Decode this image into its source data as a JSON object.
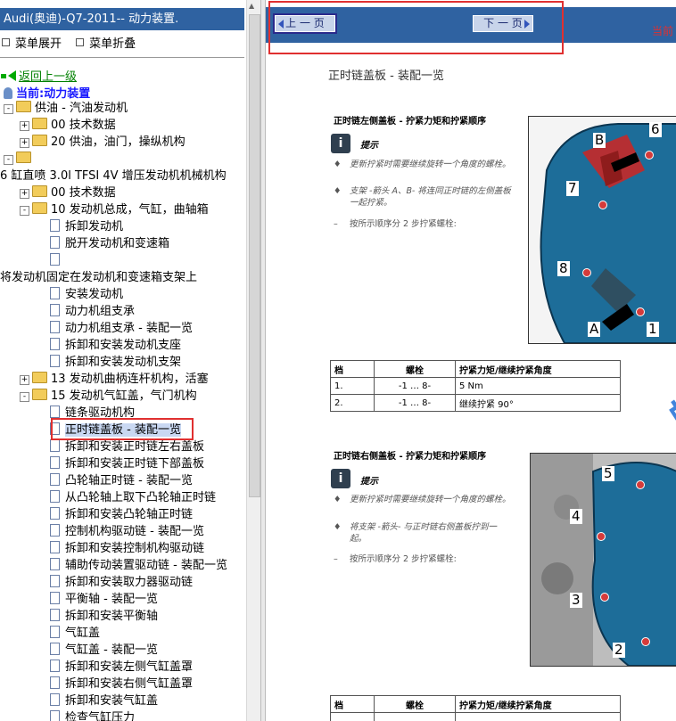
{
  "left": {
    "title": "Audi(奥迪)-Q7-2011-- 动力装置.",
    "menu": {
      "expand": "菜单展开",
      "collapse": "菜单折叠"
    },
    "back_label": "返回上一级",
    "current_label": "当前:动力装置",
    "tree": [
      {
        "indent": 0,
        "kind": "folder",
        "expander": "-",
        "label": "供油 - 汽油发动机"
      },
      {
        "indent": 1,
        "kind": "folder",
        "expander": "+",
        "label": "00 技术数据"
      },
      {
        "indent": 1,
        "kind": "folder",
        "expander": "+",
        "label": "20 供油，油门，操纵机构"
      },
      {
        "indent": 0,
        "kind": "folder",
        "expander": "-",
        "label": ""
      },
      {
        "indent": -1,
        "kind": "text",
        "expander": "",
        "label": "6 缸直喷 3.0l TFSI 4V 增压发动机机械机构"
      },
      {
        "indent": 1,
        "kind": "folder",
        "expander": "+",
        "label": "00 技术数据"
      },
      {
        "indent": 1,
        "kind": "folder",
        "expander": "-",
        "label": "10 发动机总成，气缸，曲轴箱"
      },
      {
        "indent": 2,
        "kind": "page",
        "expander": "",
        "label": "拆卸发动机"
      },
      {
        "indent": 2,
        "kind": "page",
        "expander": "",
        "label": "脱开发动机和变速箱"
      },
      {
        "indent": 2,
        "kind": "page",
        "expander": "",
        "label": ""
      },
      {
        "indent": -1,
        "kind": "text",
        "expander": "",
        "label": "将发动机固定在发动机和变速箱支架上"
      },
      {
        "indent": 2,
        "kind": "page",
        "expander": "",
        "label": "安装发动机"
      },
      {
        "indent": 2,
        "kind": "page",
        "expander": "",
        "label": "动力机组支承"
      },
      {
        "indent": 2,
        "kind": "page",
        "expander": "",
        "label": "动力机组支承 - 装配一览"
      },
      {
        "indent": 2,
        "kind": "page",
        "expander": "",
        "label": "拆卸和安装发动机支座"
      },
      {
        "indent": 2,
        "kind": "page",
        "expander": "",
        "label": "拆卸和安装发动机支架"
      },
      {
        "indent": 1,
        "kind": "folder",
        "expander": "+",
        "label": "13 发动机曲柄连杆机构，活塞"
      },
      {
        "indent": 1,
        "kind": "folder",
        "expander": "-",
        "label": "15 发动机气缸盖，气门机构"
      },
      {
        "indent": 2,
        "kind": "page",
        "expander": "",
        "label": "链条驱动机构"
      },
      {
        "indent": 2,
        "kind": "page",
        "expander": "",
        "label": "正时链盖板 - 装配一览",
        "selected": true
      },
      {
        "indent": 2,
        "kind": "page",
        "expander": "",
        "label": "拆卸和安装正时链左右盖板"
      },
      {
        "indent": 2,
        "kind": "page",
        "expander": "",
        "label": "拆卸和安装正时链下部盖板"
      },
      {
        "indent": 2,
        "kind": "page",
        "expander": "",
        "label": "凸轮轴正时链 - 装配一览"
      },
      {
        "indent": 2,
        "kind": "page",
        "expander": "",
        "label": "从凸轮轴上取下凸轮轴正时链"
      },
      {
        "indent": 2,
        "kind": "page",
        "expander": "",
        "label": "拆卸和安装凸轮轴正时链"
      },
      {
        "indent": 2,
        "kind": "page",
        "expander": "",
        "label": "控制机构驱动链 - 装配一览"
      },
      {
        "indent": 2,
        "kind": "page",
        "expander": "",
        "label": "拆卸和安装控制机构驱动链"
      },
      {
        "indent": 2,
        "kind": "page",
        "expander": "",
        "label": "辅助传动装置驱动链 - 装配一览"
      },
      {
        "indent": 2,
        "kind": "page",
        "expander": "",
        "label": "拆卸和安装取力器驱动链"
      },
      {
        "indent": 2,
        "kind": "page",
        "expander": "",
        "label": "平衡轴 - 装配一览"
      },
      {
        "indent": 2,
        "kind": "page",
        "expander": "",
        "label": "拆卸和安装平衡轴"
      },
      {
        "indent": 2,
        "kind": "page",
        "expander": "",
        "label": "气缸盖"
      },
      {
        "indent": 2,
        "kind": "page",
        "expander": "",
        "label": "气缸盖 - 装配一览"
      },
      {
        "indent": 2,
        "kind": "page",
        "expander": "",
        "label": "拆卸和安装左侧气缸盖罩"
      },
      {
        "indent": 2,
        "kind": "page",
        "expander": "",
        "label": "拆卸和安装右侧气缸盖罩"
      },
      {
        "indent": 2,
        "kind": "page",
        "expander": "",
        "label": "拆卸和安装气缸盖"
      },
      {
        "indent": 2,
        "kind": "page",
        "expander": "",
        "label": "检查气缸压力"
      }
    ]
  },
  "right": {
    "prev_label": "上 一 页",
    "next_label": "下 一 页",
    "current_label": "当前",
    "doc_title": "正时链盖板 - 装配一览",
    "section1": {
      "title": "正时链左侧盖板 - 拧紧力矩和拧紧顺序",
      "hint": "提示",
      "bullets": [
        {
          "mark": "♦",
          "text": "更新拧紧时需要继续旋转一个角度的螺栓。"
        },
        {
          "mark": "♦",
          "text": "支架 -箭头 A、B- 将连同正时链的左侧盖板一起拧紧。"
        },
        {
          "mark": "–",
          "text": "按所示顺序分 2 步拧紧螺栓:"
        }
      ],
      "figure_labels": [
        "B",
        "6",
        "7",
        "8",
        "A",
        "1"
      ],
      "table": {
        "headers": [
          "档",
          "螺栓",
          "拧紧力矩/继续拧紧角度"
        ],
        "rows": [
          [
            "1.",
            "-1 … 8-",
            "5 Nm"
          ],
          [
            "2.",
            "-1 … 8-",
            "继续拧紧 90°"
          ]
        ]
      }
    },
    "section2": {
      "title": "正时链右侧盖板 - 拧紧力矩和拧紧顺序",
      "hint": "提示",
      "bullets": [
        {
          "mark": "♦",
          "text": "更新拧紧时需要继续旋转一个角度的螺栓。"
        },
        {
          "mark": "♦",
          "text": "将支架 -箭头- 与正时链右侧盖板拧到一起。"
        },
        {
          "mark": "–",
          "text": "按所示顺序分 2 步拧紧螺栓:"
        }
      ],
      "figure_labels": [
        "5",
        "4",
        "3",
        "2"
      ],
      "table": {
        "headers": [
          "档",
          "螺栓",
          "拧紧力矩/继续拧紧角度"
        ]
      }
    },
    "watermark": "畅易汽车维修平"
  }
}
